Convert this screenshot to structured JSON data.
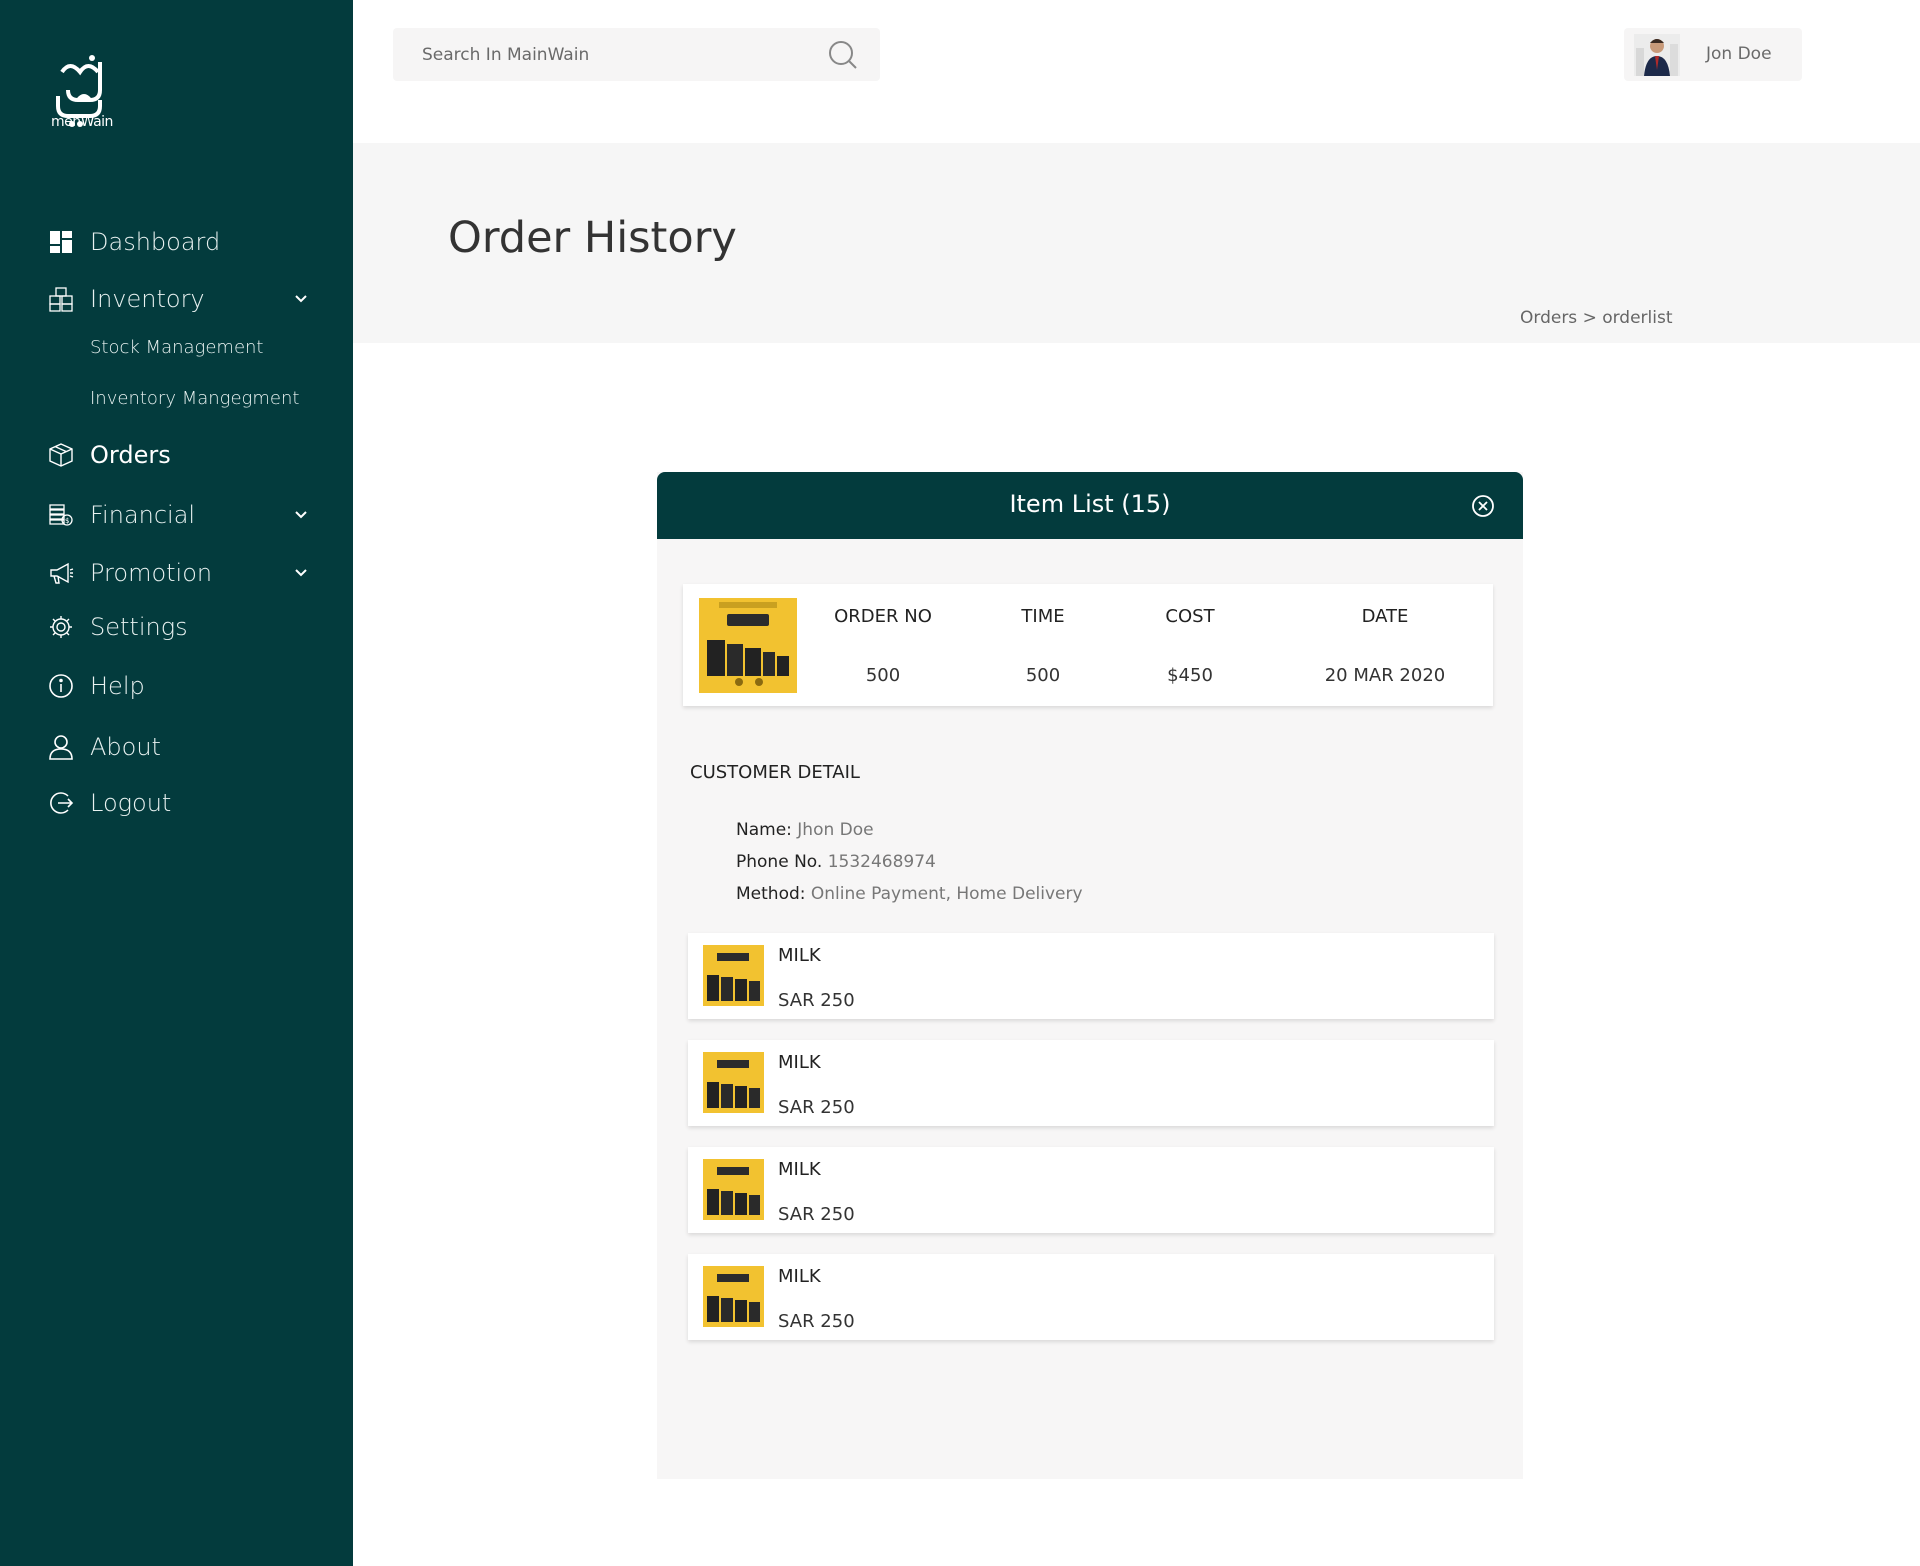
{
  "app": {
    "logo_text": "menWain"
  },
  "sidebar": {
    "items": [
      {
        "label": "Dashboard",
        "icon": "dashboard-icon"
      },
      {
        "label": "Inventory",
        "icon": "inventory-icon"
      },
      {
        "label": "Orders",
        "icon": "orders-icon"
      },
      {
        "label": "Financial",
        "icon": "financial-icon"
      },
      {
        "label": "Promotion",
        "icon": "promotion-icon"
      },
      {
        "label": "Settings",
        "icon": "settings-icon"
      },
      {
        "label": "Help",
        "icon": "help-icon"
      },
      {
        "label": "About",
        "icon": "about-icon"
      },
      {
        "label": "Logout",
        "icon": "logout-icon"
      }
    ],
    "inventory_sub": [
      "Stock Management",
      "Inventory Mangegment"
    ],
    "active": "Orders"
  },
  "search": {
    "placeholder": "Search In MainWain"
  },
  "user": {
    "name": "Jon Doe"
  },
  "page": {
    "title": "Order History",
    "breadcrumb": "Orders > orderlist"
  },
  "panel": {
    "title": "Item List (15)",
    "order": {
      "headers": [
        "ORDER NO",
        "TIME",
        "COST",
        "DATE"
      ],
      "values": [
        "500",
        "500",
        "$450",
        "20 MAR 2020"
      ]
    },
    "customer": {
      "title": "CUSTOMER DETAIL",
      "name_label": "Name:",
      "name_value": "Jhon Doe",
      "phone_label": "Phone No.",
      "phone_value": "1532468974",
      "method_label": "Method:",
      "method_value": "Online Payment, Home Delivery"
    },
    "items": [
      {
        "name": "MILK",
        "price": "SAR 250"
      },
      {
        "name": "MILK",
        "price": "SAR 250"
      },
      {
        "name": "MILK",
        "price": "SAR 250"
      },
      {
        "name": "MILK",
        "price": "SAR 250"
      }
    ]
  },
  "colors": {
    "sidebar_bg": "#033b3d",
    "panel_head": "#033b3d",
    "product_yellow": "#f2c230"
  }
}
